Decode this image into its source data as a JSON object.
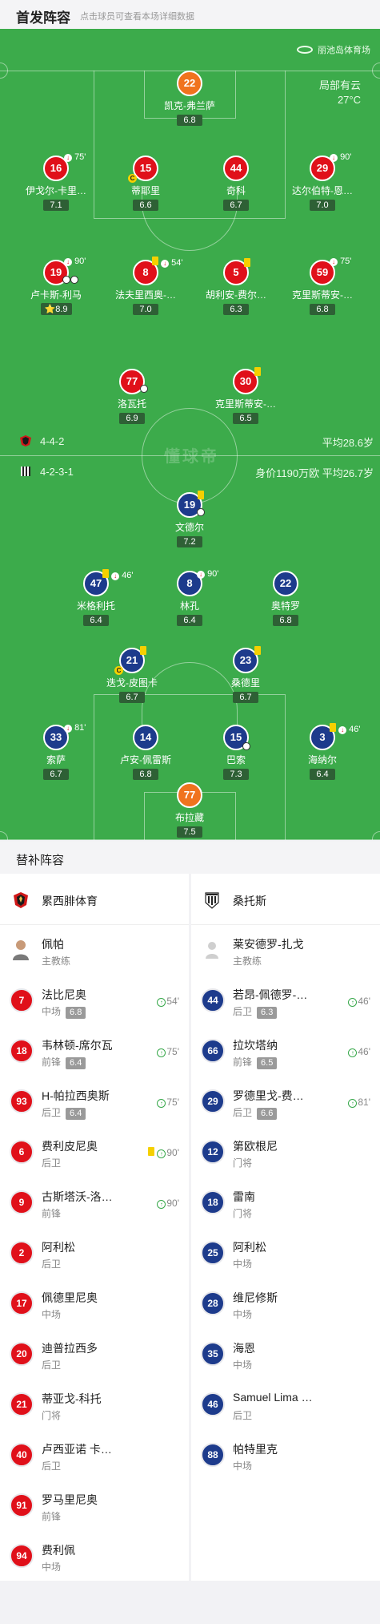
{
  "header": {
    "title": "首发阵容",
    "subtitle": "点击球员可查看本场详细数据"
  },
  "venue": {
    "name": "丽池岛体育场",
    "weather": "局部有云",
    "temp": "27°C"
  },
  "home": {
    "formation": "4-4-2",
    "avg_age": "平均28.6岁",
    "name": "累西腓体育",
    "coach": "佩帕",
    "coach_role": "主教练"
  },
  "away": {
    "formation": "4-2-3-1",
    "value_age": "身价1190万欧 平均26.7岁",
    "name": "桑托斯",
    "coach": "莱安德罗-扎戈",
    "coach_role": "主教练"
  },
  "watermark": "懂球帝",
  "home_players": [
    {
      "num": "22",
      "name": "凯克-弗兰萨",
      "rating": "6.8"
    },
    {
      "num": "16",
      "name": "伊戈尔-卡里…",
      "rating": "7.1",
      "sub": "75'"
    },
    {
      "num": "15",
      "name": "蒂耶里",
      "rating": "6.6"
    },
    {
      "num": "44",
      "name": "奇科",
      "rating": "6.7"
    },
    {
      "num": "29",
      "name": "达尔伯特-恩…",
      "rating": "7.0",
      "sub": "90'"
    },
    {
      "num": "19",
      "name": "卢卡斯-利马",
      "rating": "8.9",
      "sub": "90'"
    },
    {
      "num": "8",
      "name": "法夫里西奥-…",
      "rating": "7.0",
      "sub": "54'"
    },
    {
      "num": "5",
      "name": "胡利安-费尔…",
      "rating": "6.3"
    },
    {
      "num": "59",
      "name": "克里斯蒂安-…",
      "rating": "6.8",
      "sub": "75'"
    },
    {
      "num": "77",
      "name": "洛瓦托",
      "rating": "6.9"
    },
    {
      "num": "30",
      "name": "克里斯蒂安-…",
      "rating": "6.5"
    }
  ],
  "away_players": [
    {
      "num": "19",
      "name": "文德尔",
      "rating": "7.2"
    },
    {
      "num": "47",
      "name": "米格利托",
      "rating": "6.4",
      "sub": "46'"
    },
    {
      "num": "8",
      "name": "林孔",
      "rating": "6.4",
      "sub": "90'"
    },
    {
      "num": "22",
      "name": "奥特罗",
      "rating": "6.8"
    },
    {
      "num": "21",
      "name": "迭戈-皮图卡",
      "rating": "6.7"
    },
    {
      "num": "23",
      "name": "桑德里",
      "rating": "6.7"
    },
    {
      "num": "33",
      "name": "索萨",
      "rating": "6.7",
      "sub": "81'"
    },
    {
      "num": "14",
      "name": "卢安-佩雷斯",
      "rating": "6.8"
    },
    {
      "num": "15",
      "name": "巴索",
      "rating": "7.3"
    },
    {
      "num": "3",
      "name": "海纳尔",
      "rating": "6.4",
      "sub": "46'"
    },
    {
      "num": "77",
      "name": "布拉藏",
      "rating": "7.5"
    }
  ],
  "subs_title": "替补阵容",
  "home_subs": [
    {
      "num": "7",
      "name": "法比尼奥",
      "pos": "中场",
      "rating": "6.8",
      "ev": "54'"
    },
    {
      "num": "18",
      "name": "韦林顿-席尔瓦",
      "pos": "前锋",
      "rating": "6.4",
      "ev": "75'"
    },
    {
      "num": "93",
      "name": "H-帕拉西奥斯",
      "pos": "后卫",
      "rating": "6.4",
      "ev": "75'"
    },
    {
      "num": "6",
      "name": "费利皮尼奥",
      "pos": "后卫",
      "ev": "90'"
    },
    {
      "num": "9",
      "name": "古斯塔沃-洛…",
      "pos": "前锋",
      "ev": "90'"
    },
    {
      "num": "2",
      "name": "阿利松",
      "pos": "后卫"
    },
    {
      "num": "17",
      "name": "佩德里尼奥",
      "pos": "中场"
    },
    {
      "num": "20",
      "name": "迪普拉西多",
      "pos": "后卫"
    },
    {
      "num": "21",
      "name": "蒂亚戈-科托",
      "pos": "门将"
    },
    {
      "num": "40",
      "name": "卢西亚诺 卡…",
      "pos": "后卫"
    },
    {
      "num": "91",
      "name": "罗马里尼奥",
      "pos": "前锋"
    },
    {
      "num": "94",
      "name": "费利佩",
      "pos": "中场"
    }
  ],
  "away_subs": [
    {
      "num": "44",
      "name": "若昂-佩德罗-…",
      "pos": "后卫",
      "rating": "6.3",
      "ev": "46'"
    },
    {
      "num": "66",
      "name": "拉坎塔纳",
      "pos": "前锋",
      "rating": "6.5",
      "ev": "46'"
    },
    {
      "num": "29",
      "name": "罗德里戈-费…",
      "pos": "后卫",
      "rating": "6.6",
      "ev": "81'"
    },
    {
      "num": "12",
      "name": "第欧根尼",
      "pos": "门将"
    },
    {
      "num": "18",
      "name": "雷南",
      "pos": "门将"
    },
    {
      "num": "25",
      "name": "阿利松",
      "pos": "中场"
    },
    {
      "num": "28",
      "name": "维尼修斯",
      "pos": "中场"
    },
    {
      "num": "35",
      "name": "海恩",
      "pos": "中场"
    },
    {
      "num": "46",
      "name": "Samuel Lima …",
      "pos": "后卫"
    },
    {
      "num": "88",
      "name": "帕特里克",
      "pos": "中场"
    }
  ]
}
